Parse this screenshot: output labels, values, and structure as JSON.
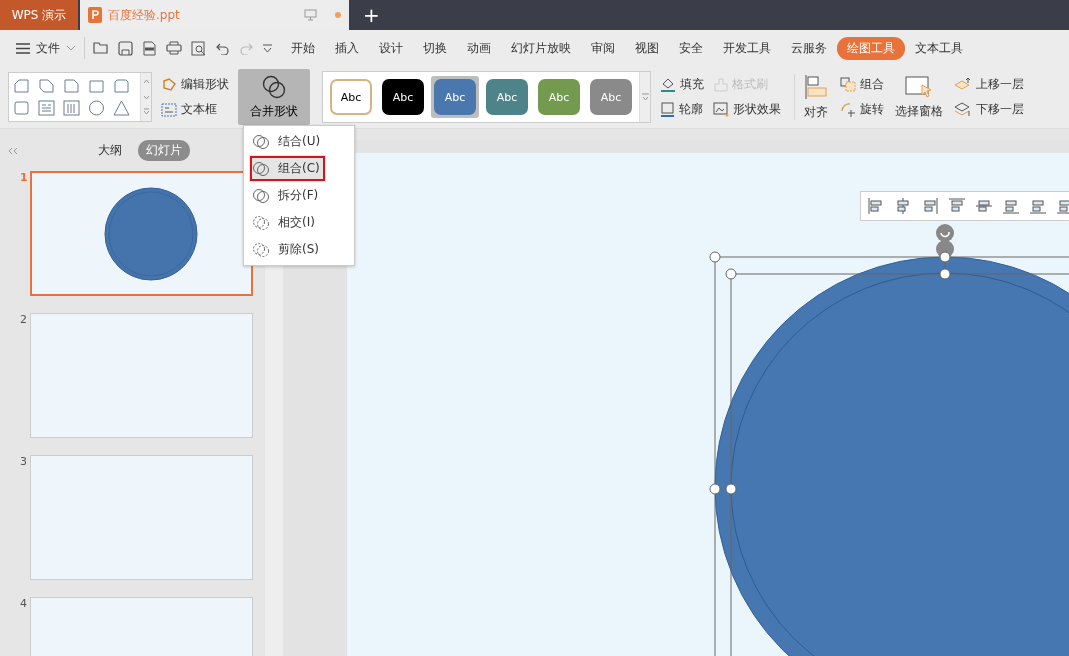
{
  "title_bar": {
    "app_label": "WPS 演示",
    "document_tab": {
      "title": "百度经验.ppt",
      "modified": true
    },
    "new_tab": "+"
  },
  "menu_bar": {
    "file_menu": "文件",
    "tabs": [
      {
        "label": "开始",
        "selected": false
      },
      {
        "label": "插入",
        "selected": false
      },
      {
        "label": "设计",
        "selected": false
      },
      {
        "label": "切换",
        "selected": false
      },
      {
        "label": "动画",
        "selected": false
      },
      {
        "label": "幻灯片放映",
        "selected": false
      },
      {
        "label": "审阅",
        "selected": false
      },
      {
        "label": "视图",
        "selected": false
      },
      {
        "label": "安全",
        "selected": false
      },
      {
        "label": "开发工具",
        "selected": false
      },
      {
        "label": "云服务",
        "selected": false
      },
      {
        "label": "绘图工具",
        "selected": true
      },
      {
        "label": "文本工具",
        "selected": false
      }
    ]
  },
  "ribbon": {
    "edit_shape": "编辑形状",
    "text_box": "文本框",
    "merge_shapes": {
      "label": "合并形状",
      "pressed": true
    },
    "styles": [
      {
        "label": "Abc",
        "color": "#ffffff",
        "selected": false
      },
      {
        "label": "Abc",
        "color": "#000000",
        "selected": false
      },
      {
        "label": "Abc",
        "color": "#4a78ae",
        "selected": true
      },
      {
        "label": "Abc",
        "color": "#4e8489",
        "selected": false
      },
      {
        "label": "Abc",
        "color": "#739a4e",
        "selected": false
      },
      {
        "label": "Abc",
        "color": "#8a8a8a",
        "selected": false
      }
    ],
    "fill": "填充",
    "format_painter": {
      "label": "格式刷",
      "disabled": true
    },
    "outline": "轮廓",
    "shape_effect": "形状效果",
    "align": "对齐",
    "group": "组合",
    "rotate": "旋转",
    "selection_pane": "选择窗格",
    "bring_forward": "上移一层",
    "send_backward": "下移一层"
  },
  "merge_menu": {
    "items": [
      {
        "label": "结合(U)",
        "selected": false
      },
      {
        "label": "组合(C)",
        "selected": true
      },
      {
        "label": "拆分(F)",
        "selected": false
      },
      {
        "label": "相交(I)",
        "selected": false
      },
      {
        "label": "剪除(S)",
        "selected": false
      }
    ]
  },
  "slide_panel": {
    "view_tabs": [
      {
        "label": "大纲",
        "selected": false
      },
      {
        "label": "幻灯片",
        "selected": true
      }
    ],
    "slides": [
      {
        "number": "1",
        "selected": true,
        "has_circle": true
      },
      {
        "number": "2",
        "selected": false,
        "has_circle": false
      },
      {
        "number": "3",
        "selected": false,
        "has_circle": false
      },
      {
        "number": "4",
        "selected": false,
        "has_circle": false
      }
    ]
  }
}
